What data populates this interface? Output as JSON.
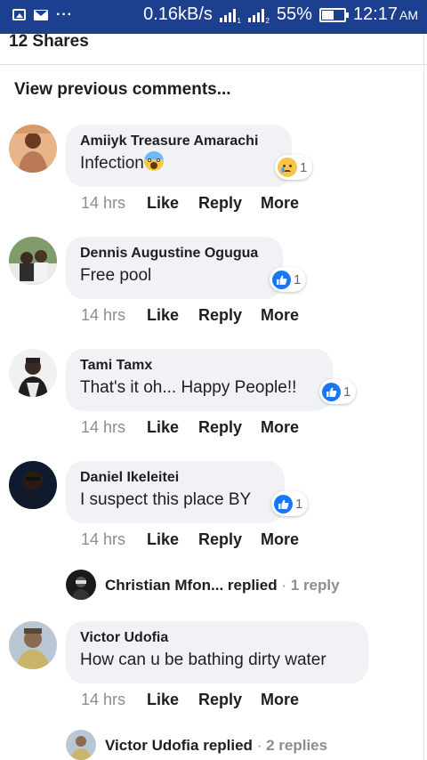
{
  "status_bar": {
    "speed": "0.16kB/s",
    "battery_percent": "55%",
    "battery_level": 0.55,
    "time": "12:17",
    "ampm": "AM",
    "sim1": "1",
    "sim2": "2"
  },
  "post": {
    "shares": "12 Shares",
    "view_previous": "View previous comments..."
  },
  "comments": [
    {
      "author": "Amiiyk Treasure Amarachi",
      "text": "Infection",
      "emoji": "scream-emoji",
      "reaction": "sad",
      "reaction_count": "1",
      "time": "14 hrs",
      "like": "Like",
      "reply": "Reply",
      "more": "More"
    },
    {
      "author": "Dennis Augustine Ogugua",
      "text": "Free pool",
      "reaction": "like",
      "reaction_count": "1",
      "time": "14 hrs",
      "like": "Like",
      "reply": "Reply",
      "more": "More"
    },
    {
      "author": "Tami Tamx",
      "text": "That's it oh... Happy People!!",
      "reaction": "like",
      "reaction_count": "1",
      "time": "14 hrs",
      "like": "Like",
      "reply": "Reply",
      "more": "More"
    },
    {
      "author": "Daniel Ikeleitei",
      "text": "I suspect this place BY",
      "reaction": "like",
      "reaction_count": "1",
      "time": "14 hrs",
      "like": "Like",
      "reply": "Reply",
      "more": "More",
      "replies_summary": {
        "name": "Christian Mfon... replied",
        "separator": "·",
        "count": "1 reply"
      }
    },
    {
      "author": "Victor Udofia",
      "text": "How can u be bathing dirty water",
      "time": "14 hrs",
      "like": "Like",
      "reply": "Reply",
      "more": "More",
      "replies_summary": {
        "name": "Victor Udofia replied",
        "separator": "·",
        "count": "2 replies"
      }
    }
  ],
  "colors": {
    "status_bar": "#1d3f8f",
    "bubble": "#f0f2f5",
    "like_blue": "#1877f2",
    "meta_gray": "#8a8d91"
  }
}
